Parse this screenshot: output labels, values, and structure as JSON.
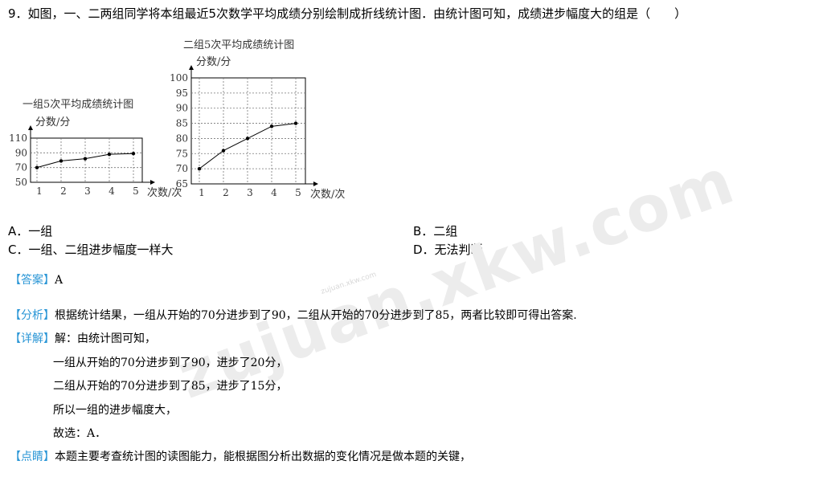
{
  "question": {
    "text": "9．如图，一、二两组同学将本组最近5次数学平均成绩分别绘制成折线统计图．由统计图可知，成绩进步幅度大的组是（　　）"
  },
  "chart_data": [
    {
      "type": "line",
      "title": "一组5次平均成绩统计图",
      "ylabel": "分数/分",
      "xlabel": "次数/次",
      "categories": [
        "1",
        "2",
        "3",
        "4",
        "5"
      ],
      "y_ticks": [
        "110",
        "90",
        "70",
        "50"
      ],
      "ylim": [
        50,
        110
      ],
      "series": [
        {
          "values": [
            70,
            79,
            82,
            88,
            89
          ]
        }
      ],
      "grid": true
    },
    {
      "type": "line",
      "title": "二组5次平均成绩统计图",
      "ylabel": "分数/分",
      "xlabel": "次数/次",
      "categories": [
        "1",
        "2",
        "3",
        "4",
        "5"
      ],
      "y_ticks": [
        "100",
        "95",
        "90",
        "85",
        "80",
        "75",
        "70",
        "65"
      ],
      "ylim": [
        65,
        100
      ],
      "series": [
        {
          "values": [
            70,
            76,
            80,
            84,
            85
          ]
        }
      ],
      "grid": true
    }
  ],
  "options": {
    "a": "A．一组",
    "b": "B．二组",
    "c": "C．一组、二组进步幅度一样大",
    "d": "D．无法判断"
  },
  "answer": {
    "tag": "【答案】",
    "text": "A"
  },
  "analysis": {
    "tag": "【分析】",
    "text": "根据统计结果，一组从开始的70分进步到了90，二组从开始的70分进步到了85，两者比较即可得出答案."
  },
  "detail": {
    "tag": "【详解】",
    "lines": [
      "解：由统计图可知，",
      "一组从开始的70分进步到了90，进步了20分，",
      "二组从开始的70分进步到了85，进步了15分，",
      "所以一组的进步幅度大，",
      "故选：A．"
    ]
  },
  "comment": {
    "tag": "【点睛】",
    "text": "本题主要考查统计图的读图能力，能根据图分析出数据的变化情况是做本题的关键，"
  },
  "watermark": {
    "main": "zujuan.xkw.com",
    "small": "zujuan.xkw.com"
  }
}
